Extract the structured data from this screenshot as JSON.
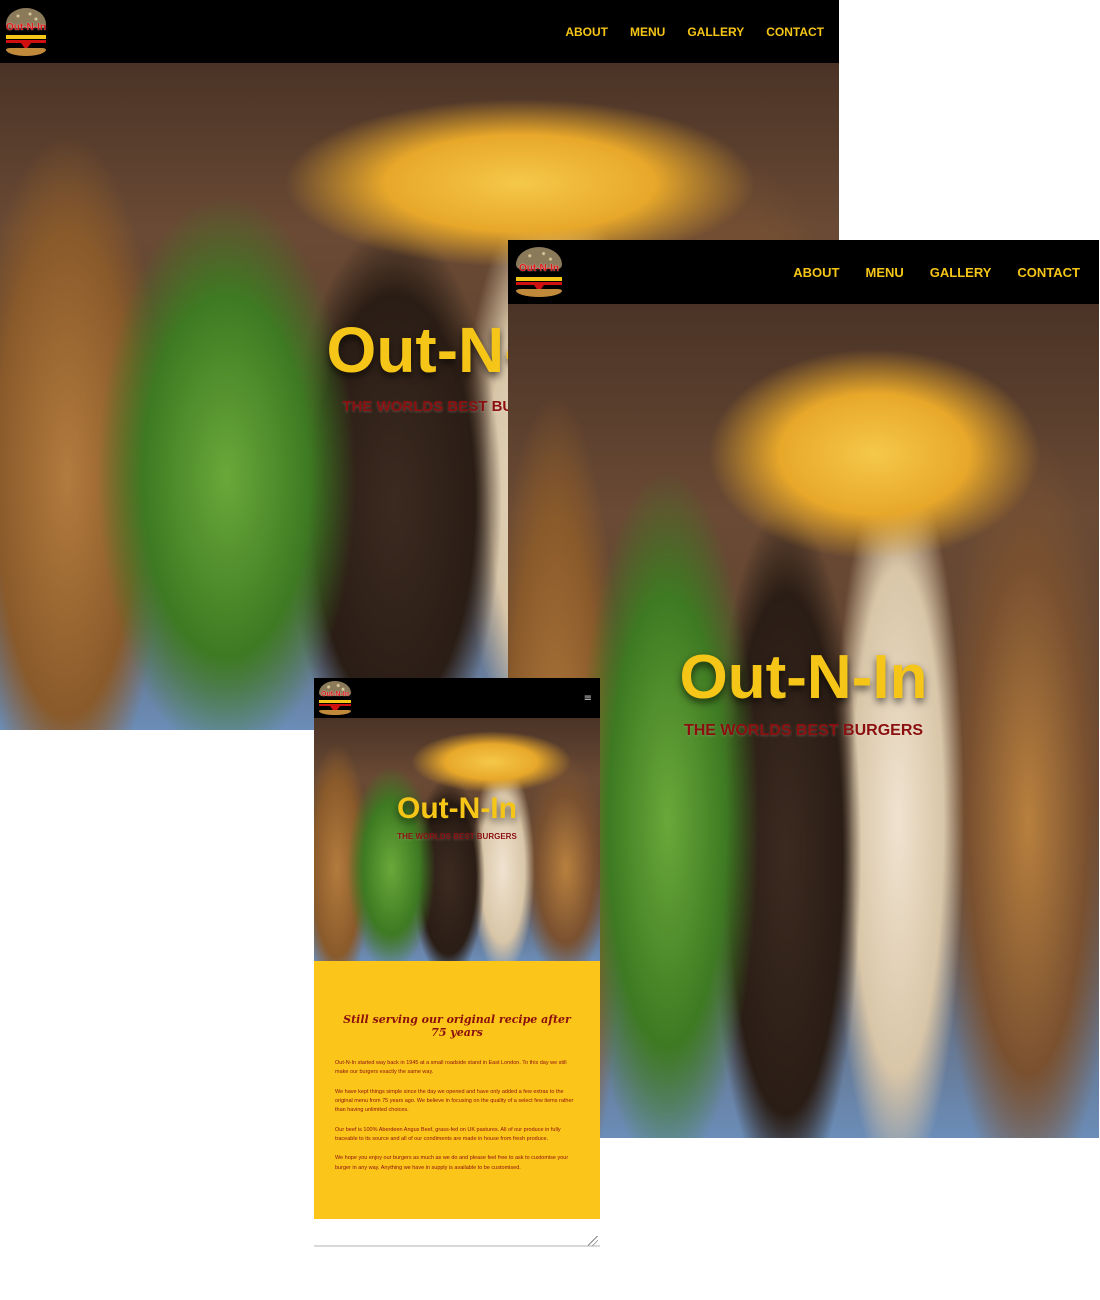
{
  "brand": {
    "logo_text": "Out-N-In"
  },
  "nav": {
    "items": [
      {
        "label": "ABOUT"
      },
      {
        "label": "MENU"
      },
      {
        "label": "GALLERY"
      },
      {
        "label": "CONTACT"
      }
    ],
    "hamburger_icon": "≡"
  },
  "hero": {
    "title": "Out-N-In",
    "subtitle": "THE WORLDS BEST BURGERS"
  },
  "about": {
    "heading": "Still serving our original recipe after 75 years",
    "paragraphs": [
      "Out-N-In started way back in 1945 at a small roadside stand in East London. To this day we still make our burgers exactly the same way.",
      "We have kept things simple since the day we opened and have only added a few extras to the original menu from 75 years ago. We believe in focusing on the quality of a select few items rather than having unlimited choices.",
      "Our beef is 100% Aberdeen Angus Beef, grass-fed on UK pastures. All of our produce in fully traceable to its source and all of our condiments are made in house from fresh produce.",
      "We hope you enjoy our burgers as much as we do and please feel free to ask to customise your burger in any way. Anything we have in supply is available to be customised."
    ]
  },
  "colors": {
    "accent_yellow": "#f5c518",
    "accent_red": "#8b0f0f",
    "nav_bg": "#000000",
    "about_bg": "#fbc51a"
  }
}
